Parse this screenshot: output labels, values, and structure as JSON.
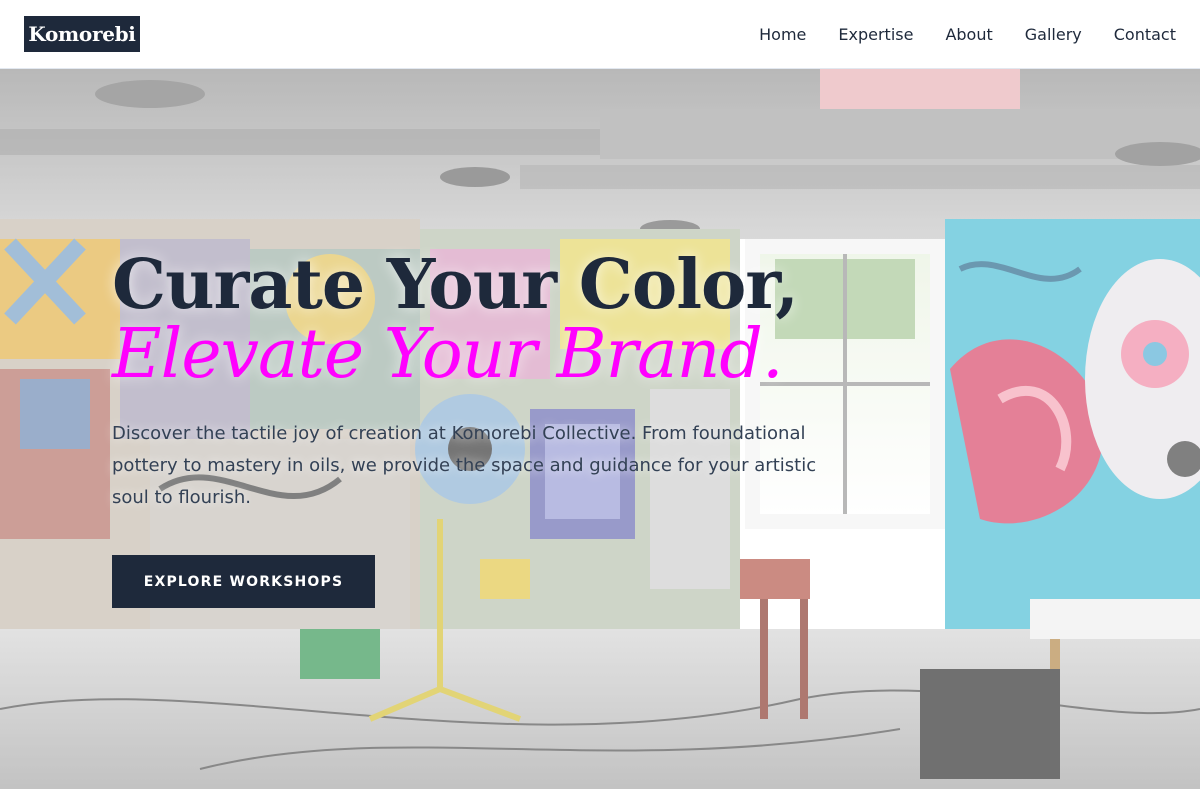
{
  "header": {
    "logo": "Komorebi",
    "nav": [
      {
        "label": "Home"
      },
      {
        "label": "Expertise"
      },
      {
        "label": "About"
      },
      {
        "label": "Gallery"
      },
      {
        "label": "Contact"
      }
    ]
  },
  "hero": {
    "headline": "Curate Your Color,",
    "headline_accent": "Elevate Your Brand.",
    "lead": "Discover the tactile joy of creation at Komorebi Collective. From foundational pottery to mastery in oils, we provide the space and guidance for your artistic soul to flourish.",
    "cta_label": "EXPLORE WORKSHOPS",
    "background": "graffiti-art-studio-photo"
  },
  "colors": {
    "primary": "#1e293b",
    "accent": "#ff00ff",
    "lead_text": "#334155",
    "header_bg": "#ffffff"
  }
}
